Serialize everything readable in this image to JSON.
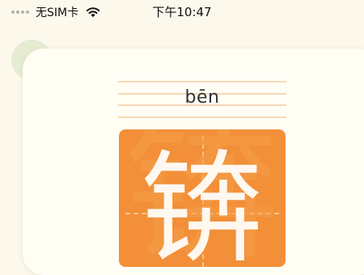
{
  "status_bar": {
    "carrier": "无SIM卡",
    "time": "下午10:47"
  },
  "word": {
    "pinyin": "bēn",
    "character": "锛"
  },
  "colors": {
    "page_background": "#fcf8ec",
    "card_background": "#fffdf4",
    "character_box": "#f28f38",
    "guide_lines": "#f6d8b5"
  }
}
